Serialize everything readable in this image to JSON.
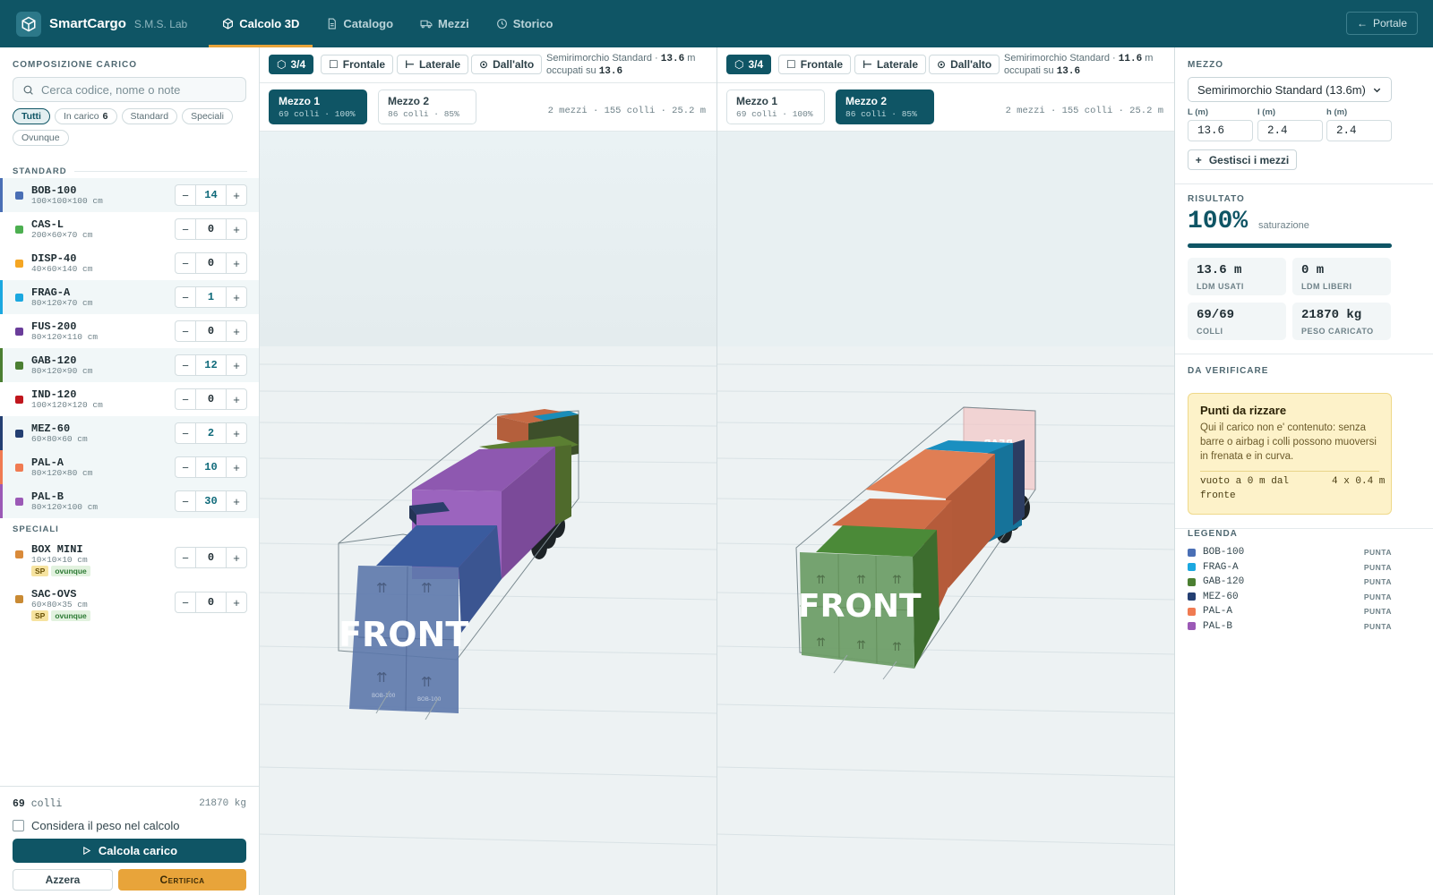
{
  "app": {
    "brand": "SmartCargo",
    "subtitle": "S.M.S. Lab",
    "portal_label": "Portale"
  },
  "nav": [
    {
      "label": "Calcolo 3D",
      "icon": "cube-icon",
      "active": true
    },
    {
      "label": "Catalogo",
      "icon": "document-icon",
      "active": false
    },
    {
      "label": "Mezzi",
      "icon": "truck-icon",
      "active": false
    },
    {
      "label": "Storico",
      "icon": "clock-icon",
      "active": false
    }
  ],
  "left": {
    "title": "COMPOSIZIONE CARICO",
    "search_placeholder": "Cerca codice, nome o note",
    "filters": [
      {
        "label": "Tutti",
        "count": "",
        "active": true
      },
      {
        "label": "In carico",
        "count": "6",
        "active": false
      },
      {
        "label": "Standard",
        "count": "",
        "active": false
      },
      {
        "label": "Speciali",
        "count": "",
        "active": false
      },
      {
        "label": "Ovunque",
        "count": "",
        "active": false
      }
    ],
    "group_standard": "STANDARD",
    "group_special": "SPECIALI",
    "standard_items": [
      {
        "code": "BOB-100",
        "dims": "100×100×100 cm",
        "qty": "14",
        "color": "#4a6fb5"
      },
      {
        "code": "CAS-L",
        "dims": "200×60×70 cm",
        "qty": "0",
        "color": "#4caf50"
      },
      {
        "code": "DISP-40",
        "dims": "40×60×140 cm",
        "qty": "0",
        "color": "#f5a623"
      },
      {
        "code": "FRAG-A",
        "dims": "80×120×70 cm",
        "qty": "1",
        "color": "#1ba8e0"
      },
      {
        "code": "FUS-200",
        "dims": "80×120×110 cm",
        "qty": "0",
        "color": "#6a3d9a"
      },
      {
        "code": "GAB-120",
        "dims": "80×120×90 cm",
        "qty": "12",
        "color": "#4b7f32"
      },
      {
        "code": "IND-120",
        "dims": "100×120×120 cm",
        "qty": "0",
        "color": "#c0161d"
      },
      {
        "code": "MEZ-60",
        "dims": "60×80×60 cm",
        "qty": "2",
        "color": "#243f72"
      },
      {
        "code": "PAL-A",
        "dims": "80×120×80 cm",
        "qty": "10",
        "color": "#f07b52"
      },
      {
        "code": "PAL-B",
        "dims": "80×120×100 cm",
        "qty": "30",
        "color": "#9b59b6"
      }
    ],
    "special_items": [
      {
        "code": "BOX MINI",
        "dims": "10×10×10 cm",
        "qty": "0",
        "color": "#d98a3a",
        "badge_sp": "SP",
        "badge_ov": "ovunque"
      },
      {
        "code": "SAC-OVS",
        "dims": "60×80×35 cm",
        "qty": "0",
        "color": "#c98a33",
        "badge_sp": "SP",
        "badge_ov": "ovunque"
      }
    ],
    "footer": {
      "count": "69",
      "count_unit": "colli",
      "weight": "21870 kg",
      "checkbox_label": "Considera il peso nel calcolo",
      "calc_label": "Calcola carico",
      "reset_label": "Azzera",
      "certify_label": "Certifica"
    }
  },
  "views": [
    {
      "toolbar": [
        "3/4",
        "Frontale",
        "Laterale",
        "Dall'alto"
      ],
      "info_pre": "Semirimorchio Standard · ",
      "info_len": "13.6",
      "info_unit": " m",
      "info_line2": "occupati su ",
      "info_total": "13.6",
      "tabs": [
        {
          "name": "Mezzo 1",
          "detail": "69 colli · 100%",
          "active": true
        },
        {
          "name": "Mezzo 2",
          "detail": "86 colli · 85%",
          "active": false
        }
      ],
      "summary": "2 mezzi · 155 colli · 25.2 m",
      "front_label": "FRONT",
      "box_label": "BOB-100"
    },
    {
      "toolbar": [
        "3/4",
        "Frontale",
        "Laterale",
        "Dall'alto"
      ],
      "info_pre": "Semirimorchio Standard · ",
      "info_len": "11.6",
      "info_unit": " m",
      "info_line2": "occupati su ",
      "info_total": "13.6",
      "tabs": [
        {
          "name": "Mezzo 1",
          "detail": "69 colli · 100%",
          "active": false
        },
        {
          "name": "Mezzo 2",
          "detail": "86 colli · 85%",
          "active": true
        }
      ],
      "summary": "2 mezzi · 155 colli · 25.2 m",
      "front_label": "FRONT",
      "rear_label": "REAR"
    }
  ],
  "right": {
    "vehicle_title": "MEZZO",
    "vehicle_selected": "Semirimorchio Standard (13.6m)",
    "dim_labels": [
      "L (m)",
      "l (m)",
      "h (m)"
    ],
    "dim_values": [
      "13.6",
      "2.4",
      "2.4"
    ],
    "manage_label": "Gestisci i mezzi",
    "result_title": "RISULTATO",
    "saturation": "100%",
    "saturation_fraction": 1.0,
    "saturation_label": "saturazione",
    "stats": [
      {
        "value": "13.6 m",
        "label": "LDM USATI"
      },
      {
        "value": "0 m",
        "label": "LDM LIBERI"
      },
      {
        "value": "69/69",
        "label": "COLLI"
      },
      {
        "value": "21870 kg",
        "label": "PESO CARICATO"
      }
    ],
    "verify_title": "DA VERIFICARE",
    "warning": {
      "title": "Punti da rizzare",
      "desc": "Qui il carico non e' contenuto: senza barre o airbag i colli possono muoversi in frenata e in curva.",
      "left": "vuoto a 0 m dal fronte",
      "right": "4 x 0.4 m"
    },
    "legend_title": "LEGENDA",
    "legend": [
      {
        "code": "BOB-100",
        "tag": "PUNTA",
        "color": "#4a6fb5"
      },
      {
        "code": "FRAG-A",
        "tag": "PUNTA",
        "color": "#1ba8e0"
      },
      {
        "code": "GAB-120",
        "tag": "PUNTA",
        "color": "#4b7f32"
      },
      {
        "code": "MEZ-60",
        "tag": "PUNTA",
        "color": "#243f72"
      },
      {
        "code": "PAL-A",
        "tag": "PUNTA",
        "color": "#f07b52"
      },
      {
        "code": "PAL-B",
        "tag": "PUNTA",
        "color": "#9b59b6"
      }
    ]
  }
}
